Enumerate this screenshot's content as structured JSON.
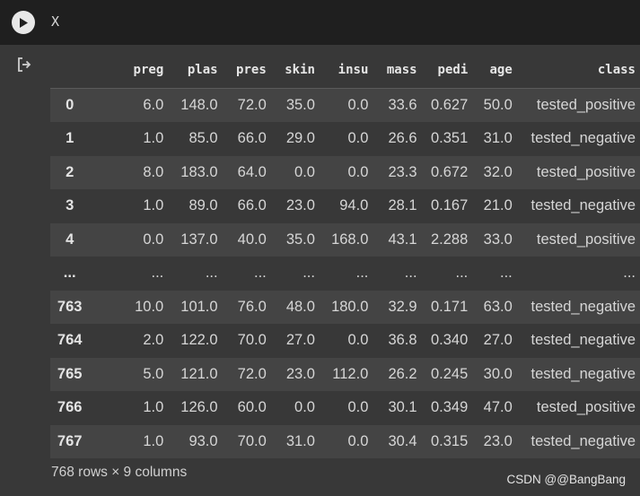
{
  "cell": {
    "code": "X"
  },
  "table": {
    "columns": [
      "",
      "preg",
      "plas",
      "pres",
      "skin",
      "insu",
      "mass",
      "pedi",
      "age",
      "class"
    ],
    "rows": [
      [
        "0",
        "6.0",
        "148.0",
        "72.0",
        "35.0",
        "0.0",
        "33.6",
        "0.627",
        "50.0",
        "tested_positive"
      ],
      [
        "1",
        "1.0",
        "85.0",
        "66.0",
        "29.0",
        "0.0",
        "26.6",
        "0.351",
        "31.0",
        "tested_negative"
      ],
      [
        "2",
        "8.0",
        "183.0",
        "64.0",
        "0.0",
        "0.0",
        "23.3",
        "0.672",
        "32.0",
        "tested_positive"
      ],
      [
        "3",
        "1.0",
        "89.0",
        "66.0",
        "23.0",
        "94.0",
        "28.1",
        "0.167",
        "21.0",
        "tested_negative"
      ],
      [
        "4",
        "0.0",
        "137.0",
        "40.0",
        "35.0",
        "168.0",
        "43.1",
        "2.288",
        "33.0",
        "tested_positive"
      ],
      [
        "...",
        "...",
        "...",
        "...",
        "...",
        "...",
        "...",
        "...",
        "...",
        "..."
      ],
      [
        "763",
        "10.0",
        "101.0",
        "76.0",
        "48.0",
        "180.0",
        "32.9",
        "0.171",
        "63.0",
        "tested_negative"
      ],
      [
        "764",
        "2.0",
        "122.0",
        "70.0",
        "27.0",
        "0.0",
        "36.8",
        "0.340",
        "27.0",
        "tested_negative"
      ],
      [
        "765",
        "5.0",
        "121.0",
        "72.0",
        "23.0",
        "112.0",
        "26.2",
        "0.245",
        "30.0",
        "tested_negative"
      ],
      [
        "766",
        "1.0",
        "126.0",
        "60.0",
        "0.0",
        "0.0",
        "30.1",
        "0.349",
        "47.0",
        "tested_positive"
      ],
      [
        "767",
        "1.0",
        "93.0",
        "70.0",
        "31.0",
        "0.0",
        "30.4",
        "0.315",
        "23.0",
        "tested_negative"
      ]
    ]
  },
  "footer": {
    "shape": "768 rows × 9 columns"
  },
  "watermark": "CSDN @@BangBang",
  "icons": {
    "run": "play-icon",
    "output": "output-redirect-icon"
  },
  "colors": {
    "background": "#383838",
    "cell_header": "#1f1f1f",
    "row_stripe": "#444444"
  }
}
